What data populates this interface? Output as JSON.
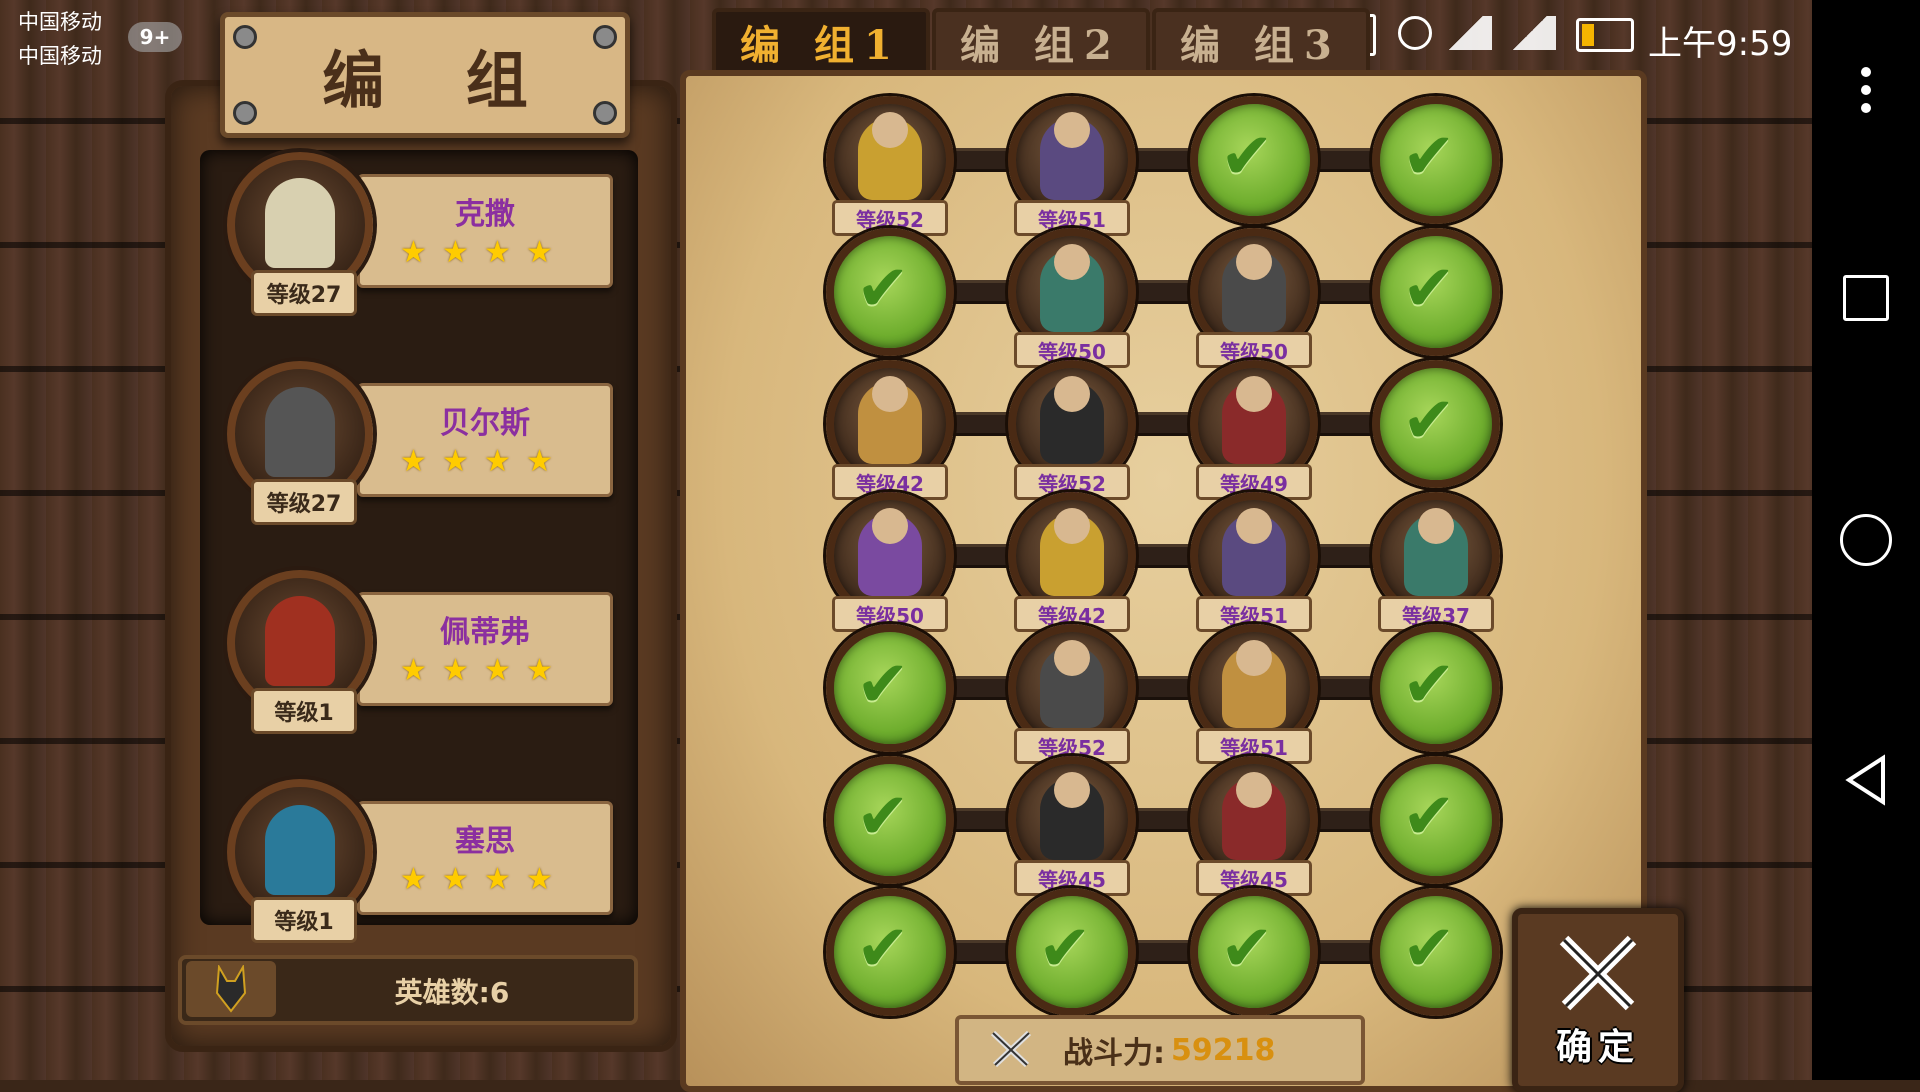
{
  "status_bar": {
    "carrier_1": "中国移动",
    "carrier_2": "中国移动",
    "notification_badge": "9+",
    "time": "上午9:59"
  },
  "left_panel": {
    "title": "编 组",
    "heroes": [
      {
        "name": "克撒",
        "level": "等级27",
        "stars": 4
      },
      {
        "name": "贝尔斯",
        "level": "等级27",
        "stars": 4
      },
      {
        "name": "佩蒂弗",
        "level": "等级1",
        "stars": 4
      },
      {
        "name": "塞思",
        "level": "等级1",
        "stars": 4
      }
    ],
    "hero_count": "英雄数:6"
  },
  "tabs": [
    {
      "label": "编 组1",
      "active": true
    },
    {
      "label": "编 组2",
      "active": false
    },
    {
      "label": "编 组3",
      "active": false
    }
  ],
  "formation": {
    "rows": [
      [
        {
          "level": "等级52"
        },
        {
          "level": "等级51"
        },
        {
          "level": null
        },
        {
          "level": null
        }
      ],
      [
        {
          "level": null
        },
        {
          "level": "等级50"
        },
        {
          "level": "等级50"
        },
        {
          "level": null
        }
      ],
      [
        {
          "level": "等级42"
        },
        {
          "level": "等级52"
        },
        {
          "level": "等级49"
        },
        {
          "level": null
        }
      ],
      [
        {
          "level": "等级50"
        },
        {
          "level": "等级42"
        },
        {
          "level": "等级51"
        },
        {
          "level": "等级37"
        }
      ],
      [
        {
          "level": null
        },
        {
          "level": "等级52"
        },
        {
          "level": "等级51"
        },
        {
          "level": null
        }
      ],
      [
        {
          "level": null
        },
        {
          "level": "等级45"
        },
        {
          "level": "等级45"
        },
        {
          "level": null
        }
      ],
      [
        {
          "level": null
        },
        {
          "level": null
        },
        {
          "level": null
        },
        {
          "level": null
        }
      ]
    ]
  },
  "combat_power": {
    "label": "战斗力:",
    "value": "59218"
  },
  "confirm_button": {
    "label": "确定"
  },
  "colors": {
    "level_text": "#7a2fa0",
    "hero_name": "#8b2fa0",
    "power_value": "#d89010",
    "active_tab_text": "#f0b030",
    "empty_slot": "#6fae2e"
  }
}
